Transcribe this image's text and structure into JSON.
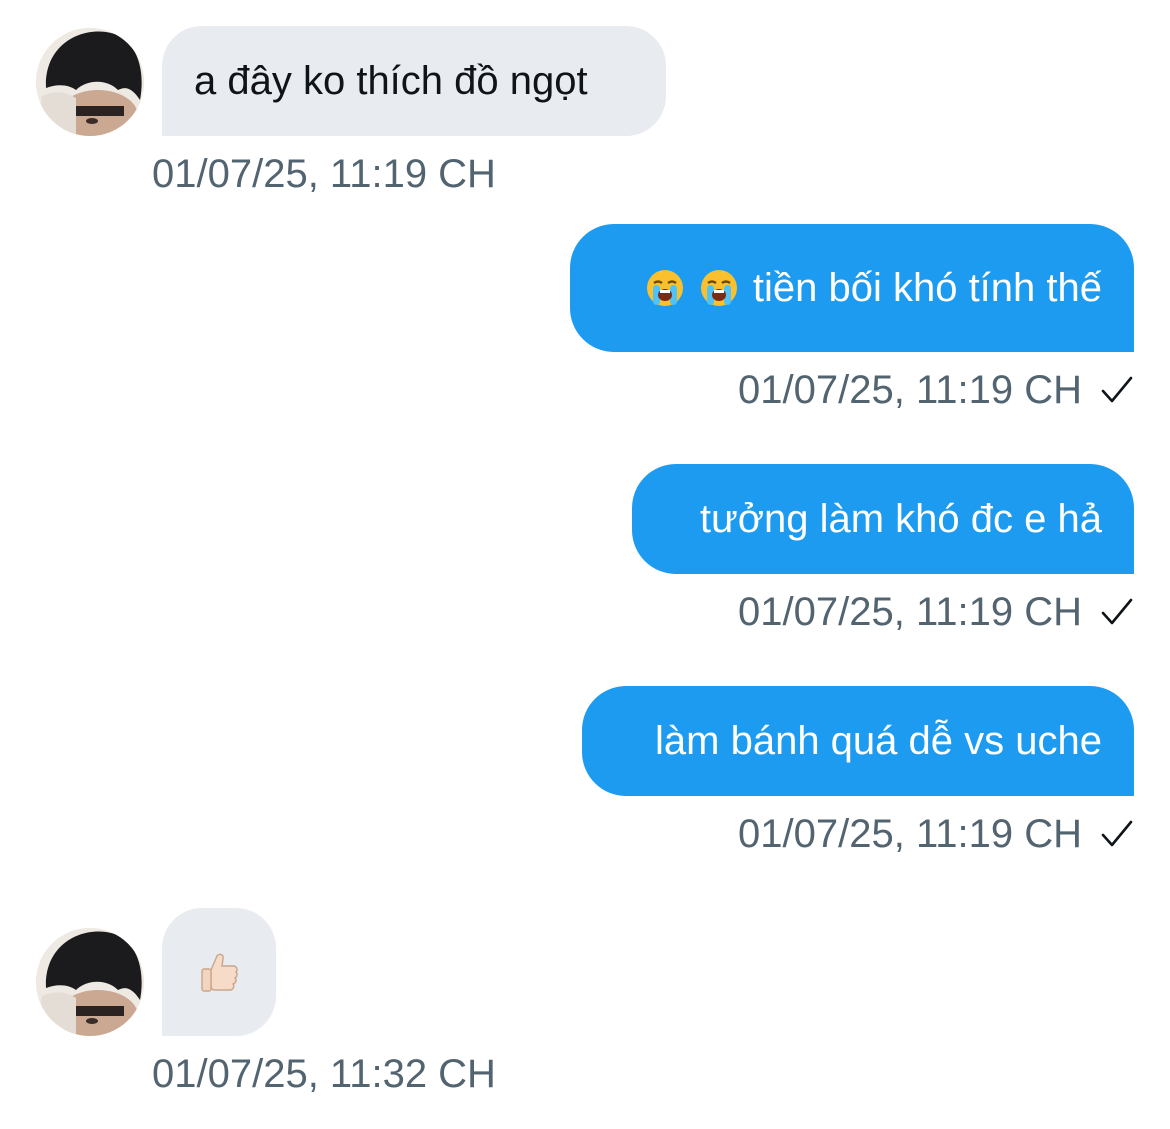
{
  "conversation": {
    "messages": [
      {
        "direction": "incoming",
        "text": "a đây ko thích đồ ngọt",
        "timestamp": "01/07/25, 11:19 CH"
      },
      {
        "direction": "outgoing",
        "emojis": [
          "loudly-crying-face",
          "loudly-crying-face"
        ],
        "text": "tiền bối khó tính thế",
        "timestamp": "01/07/25, 11:19 CH",
        "status": "sent"
      },
      {
        "direction": "outgoing",
        "text": "tưởng làm khó đc e hả",
        "timestamp": "01/07/25, 11:19 CH",
        "status": "sent"
      },
      {
        "direction": "outgoing",
        "text": "làm bánh quá dễ vs uche",
        "timestamp": "01/07/25, 11:19 CH",
        "status": "sent"
      },
      {
        "direction": "incoming",
        "emojis": [
          "thumbs-up-light-skin-tone"
        ],
        "text": "",
        "timestamp": "01/07/25, 11:32 CH"
      }
    ]
  },
  "colors": {
    "incoming_bubble": "#e8ebef",
    "outgoing_bubble": "#1d9bf0",
    "timestamp_text": "#536471",
    "incoming_text": "#0f1419",
    "outgoing_text": "#ffffff"
  }
}
